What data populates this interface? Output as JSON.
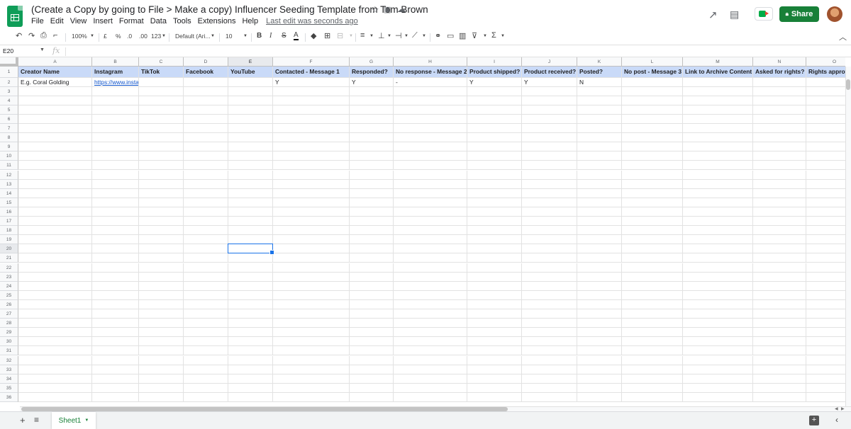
{
  "document": {
    "title": "(Create a Copy by going to File > Make a copy) Influencer Seeding Template from Tom Brown",
    "last_edit": "Last edit was seconds ago"
  },
  "menus": [
    "File",
    "Edit",
    "View",
    "Insert",
    "Format",
    "Data",
    "Tools",
    "Extensions",
    "Help"
  ],
  "header": {
    "share_label": "Share"
  },
  "toolbar": {
    "zoom": "100%",
    "currency": "£",
    "percent": "%",
    "decimal_decrease": ".0",
    "decimal_increase": ".00",
    "more_formats": "123",
    "font": "Default (Ari...",
    "font_size": "10",
    "bold": "B",
    "italic": "I",
    "strike": "S",
    "text_color": "A"
  },
  "formula_bar": {
    "name_box": "E20",
    "fx": "fx",
    "content": ""
  },
  "grid": {
    "columns": [
      "A",
      "B",
      "C",
      "D",
      "E",
      "F",
      "G",
      "H",
      "I",
      "J",
      "K",
      "L",
      "M",
      "N",
      "O"
    ],
    "selected_column": "E",
    "selected_row": "20",
    "selected_cell": "E20",
    "row_numbers": [
      "1",
      "2",
      "3",
      "4",
      "5",
      "6",
      "7",
      "8",
      "9",
      "10",
      "11",
      "12",
      "13",
      "14",
      "15",
      "16",
      "17",
      "18",
      "19",
      "20",
      "21",
      "22",
      "23",
      "24",
      "25",
      "26",
      "27",
      "28",
      "29",
      "30",
      "31",
      "32",
      "33",
      "34",
      "35",
      "36"
    ],
    "header_row": [
      "Creator Name",
      "Instagram",
      "TikTok",
      "Facebook",
      "YouTube",
      "Contacted - Message 1",
      "Responded?",
      "No response - Message 2",
      "Product shipped?",
      "Product received?",
      "Posted?",
      "No post - Message 3",
      "Link to Archive Content",
      "Asked for rights?",
      "Rights approv"
    ],
    "row2": [
      "E.g. Coral Golding",
      "https://www.insta",
      "",
      "",
      "",
      "Y",
      "Y",
      "-",
      "Y",
      "Y",
      "N",
      "",
      "",
      "",
      ""
    ],
    "header_fill": "#c9daf8",
    "link_color": "#1155cc"
  },
  "sheets": {
    "tabs": [
      "Sheet1"
    ],
    "active": "Sheet1"
  },
  "colors": {
    "share": "#188038",
    "selection": "#1a73e8",
    "sheets_logo": "#0f9d58"
  }
}
